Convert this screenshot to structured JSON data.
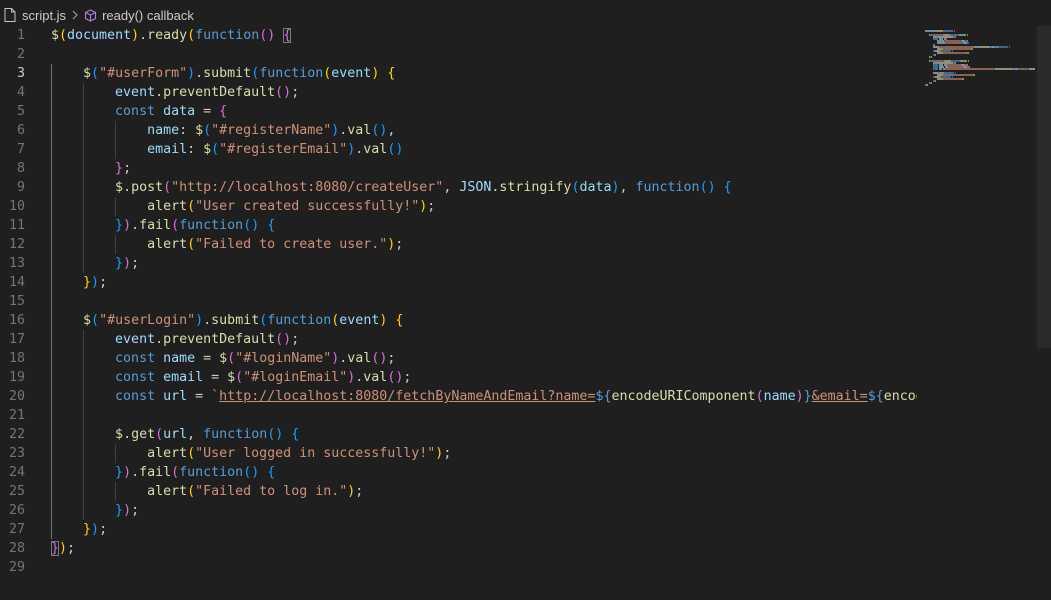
{
  "breadcrumb": {
    "file": "script.js",
    "symbol": "ready() callback",
    "file_icon": "file-icon",
    "symbol_icon": "cube-icon"
  },
  "line_numbers": [
    "1",
    "2",
    "3",
    "4",
    "5",
    "6",
    "7",
    "8",
    "9",
    "10",
    "11",
    "12",
    "13",
    "14",
    "15",
    "16",
    "17",
    "18",
    "19",
    "20",
    "21",
    "22",
    "23",
    "24",
    "25",
    "26",
    "27",
    "28",
    "29"
  ],
  "active_line": 3,
  "code_lines": [
    [
      [
        "t-fn",
        "$"
      ],
      [
        "t-p1",
        "("
      ],
      [
        "t-var",
        "document"
      ],
      [
        "t-p1",
        ")"
      ],
      [
        "t-pl",
        "."
      ],
      [
        "t-fn",
        "ready"
      ],
      [
        "t-p1",
        "("
      ],
      [
        "t-kw",
        "function"
      ],
      [
        "t-p2",
        "()"
      ],
      [
        "t-pl",
        " "
      ],
      [
        "t-p2 cursor-bracket",
        "{"
      ]
    ],
    [],
    [
      [
        "t-pl",
        "    "
      ],
      [
        "t-fn",
        "$"
      ],
      [
        "t-p3",
        "("
      ],
      [
        "t-str",
        "\"#userForm\""
      ],
      [
        "t-p3",
        ")"
      ],
      [
        "t-pl",
        "."
      ],
      [
        "t-fn",
        "submit"
      ],
      [
        "t-p3",
        "("
      ],
      [
        "t-kw",
        "function"
      ],
      [
        "t-p1",
        "("
      ],
      [
        "t-var",
        "event"
      ],
      [
        "t-p1",
        ")"
      ],
      [
        "t-pl",
        " "
      ],
      [
        "t-p1",
        "{"
      ]
    ],
    [
      [
        "t-pl",
        "        "
      ],
      [
        "t-var",
        "event"
      ],
      [
        "t-pl",
        "."
      ],
      [
        "t-fn",
        "preventDefault"
      ],
      [
        "t-p2",
        "()"
      ],
      [
        "t-pl",
        ";"
      ]
    ],
    [
      [
        "t-pl",
        "        "
      ],
      [
        "t-kw",
        "const"
      ],
      [
        "t-pl",
        " "
      ],
      [
        "t-var",
        "data"
      ],
      [
        "t-pl",
        " = "
      ],
      [
        "t-p2",
        "{"
      ]
    ],
    [
      [
        "t-pl",
        "            "
      ],
      [
        "t-var",
        "name"
      ],
      [
        "t-pl",
        ": "
      ],
      [
        "t-fn",
        "$"
      ],
      [
        "t-p3",
        "("
      ],
      [
        "t-str",
        "\"#registerName\""
      ],
      [
        "t-p3",
        ")"
      ],
      [
        "t-pl",
        "."
      ],
      [
        "t-fn",
        "val"
      ],
      [
        "t-p3",
        "()"
      ],
      [
        "t-pl",
        ","
      ]
    ],
    [
      [
        "t-pl",
        "            "
      ],
      [
        "t-var",
        "email"
      ],
      [
        "t-pl",
        ": "
      ],
      [
        "t-fn",
        "$"
      ],
      [
        "t-p3",
        "("
      ],
      [
        "t-str",
        "\"#registerEmail\""
      ],
      [
        "t-p3",
        ")"
      ],
      [
        "t-pl",
        "."
      ],
      [
        "t-fn",
        "val"
      ],
      [
        "t-p3",
        "()"
      ]
    ],
    [
      [
        "t-pl",
        "        "
      ],
      [
        "t-p2",
        "}"
      ],
      [
        "t-pl",
        ";"
      ]
    ],
    [
      [
        "t-pl",
        "        "
      ],
      [
        "t-fn",
        "$"
      ],
      [
        "t-pl",
        "."
      ],
      [
        "t-fn",
        "post"
      ],
      [
        "t-p2",
        "("
      ],
      [
        "t-str",
        "\"http://localhost:8080/createUser\""
      ],
      [
        "t-pl",
        ", "
      ],
      [
        "t-var",
        "JSON"
      ],
      [
        "t-pl",
        "."
      ],
      [
        "t-fn",
        "stringify"
      ],
      [
        "t-p3",
        "("
      ],
      [
        "t-var",
        "data"
      ],
      [
        "t-p3",
        ")"
      ],
      [
        "t-pl",
        ", "
      ],
      [
        "t-kw",
        "function"
      ],
      [
        "t-p3",
        "()"
      ],
      [
        "t-pl",
        " "
      ],
      [
        "t-p3",
        "{"
      ]
    ],
    [
      [
        "t-pl",
        "            "
      ],
      [
        "t-fn",
        "alert"
      ],
      [
        "t-p1",
        "("
      ],
      [
        "t-str",
        "\"User created successfully!\""
      ],
      [
        "t-p1",
        ")"
      ],
      [
        "t-pl",
        ";"
      ]
    ],
    [
      [
        "t-pl",
        "        "
      ],
      [
        "t-p3",
        "}"
      ],
      [
        "t-p2",
        ")"
      ],
      [
        "t-pl",
        "."
      ],
      [
        "t-fn",
        "fail"
      ],
      [
        "t-p2",
        "("
      ],
      [
        "t-kw",
        "function"
      ],
      [
        "t-p3",
        "()"
      ],
      [
        "t-pl",
        " "
      ],
      [
        "t-p3",
        "{"
      ]
    ],
    [
      [
        "t-pl",
        "            "
      ],
      [
        "t-fn",
        "alert"
      ],
      [
        "t-p1",
        "("
      ],
      [
        "t-str",
        "\"Failed to create user.\""
      ],
      [
        "t-p1",
        ")"
      ],
      [
        "t-pl",
        ";"
      ]
    ],
    [
      [
        "t-pl",
        "        "
      ],
      [
        "t-p3",
        "}"
      ],
      [
        "t-p2",
        ")"
      ],
      [
        "t-pl",
        ";"
      ]
    ],
    [
      [
        "t-pl",
        "    "
      ],
      [
        "t-p1",
        "}"
      ],
      [
        "t-p3",
        ")"
      ],
      [
        "t-pl",
        ";"
      ]
    ],
    [],
    [
      [
        "t-pl",
        "    "
      ],
      [
        "t-fn",
        "$"
      ],
      [
        "t-p3",
        "("
      ],
      [
        "t-str",
        "\"#userLogin\""
      ],
      [
        "t-p3",
        ")"
      ],
      [
        "t-pl",
        "."
      ],
      [
        "t-fn",
        "submit"
      ],
      [
        "t-p3",
        "("
      ],
      [
        "t-kw",
        "function"
      ],
      [
        "t-p1",
        "("
      ],
      [
        "t-var",
        "event"
      ],
      [
        "t-p1",
        ")"
      ],
      [
        "t-pl",
        " "
      ],
      [
        "t-p1",
        "{"
      ]
    ],
    [
      [
        "t-pl",
        "        "
      ],
      [
        "t-var",
        "event"
      ],
      [
        "t-pl",
        "."
      ],
      [
        "t-fn",
        "preventDefault"
      ],
      [
        "t-p2",
        "()"
      ],
      [
        "t-pl",
        ";"
      ]
    ],
    [
      [
        "t-pl",
        "        "
      ],
      [
        "t-kw",
        "const"
      ],
      [
        "t-pl",
        " "
      ],
      [
        "t-var",
        "name"
      ],
      [
        "t-pl",
        " = "
      ],
      [
        "t-fn",
        "$"
      ],
      [
        "t-p2",
        "("
      ],
      [
        "t-str",
        "\"#loginName\""
      ],
      [
        "t-p2",
        ")"
      ],
      [
        "t-pl",
        "."
      ],
      [
        "t-fn",
        "val"
      ],
      [
        "t-p2",
        "()"
      ],
      [
        "t-pl",
        ";"
      ]
    ],
    [
      [
        "t-pl",
        "        "
      ],
      [
        "t-kw",
        "const"
      ],
      [
        "t-pl",
        " "
      ],
      [
        "t-var",
        "email"
      ],
      [
        "t-pl",
        " = "
      ],
      [
        "t-fn",
        "$"
      ],
      [
        "t-p2",
        "("
      ],
      [
        "t-str",
        "\"#loginEmail\""
      ],
      [
        "t-p2",
        ")"
      ],
      [
        "t-pl",
        "."
      ],
      [
        "t-fn",
        "val"
      ],
      [
        "t-p2",
        "()"
      ],
      [
        "t-pl",
        ";"
      ]
    ],
    [
      [
        "t-pl",
        "        "
      ],
      [
        "t-kw",
        "const"
      ],
      [
        "t-pl",
        " "
      ],
      [
        "t-var",
        "url"
      ],
      [
        "t-pl",
        " = "
      ],
      [
        "t-str",
        "`"
      ],
      [
        "t-url",
        "http://localhost:8080/fetchByNameAndEmail?name="
      ],
      [
        "t-tpl",
        "${"
      ],
      [
        "t-fn",
        "encodeURIComponent"
      ],
      [
        "t-p2",
        "("
      ],
      [
        "t-var",
        "name"
      ],
      [
        "t-p2",
        ")"
      ],
      [
        "t-tpl",
        "}"
      ],
      [
        "t-url",
        "&email="
      ],
      [
        "t-tpl",
        "${"
      ],
      [
        "t-fn",
        "encodeURI"
      ]
    ],
    [],
    [
      [
        "t-pl",
        "        "
      ],
      [
        "t-fn",
        "$"
      ],
      [
        "t-pl",
        "."
      ],
      [
        "t-fn",
        "get"
      ],
      [
        "t-p2",
        "("
      ],
      [
        "t-var",
        "url"
      ],
      [
        "t-pl",
        ", "
      ],
      [
        "t-kw",
        "function"
      ],
      [
        "t-p3",
        "()"
      ],
      [
        "t-pl",
        " "
      ],
      [
        "t-p3",
        "{"
      ]
    ],
    [
      [
        "t-pl",
        "            "
      ],
      [
        "t-fn",
        "alert"
      ],
      [
        "t-p1",
        "("
      ],
      [
        "t-str",
        "\"User logged in successfully!\""
      ],
      [
        "t-p1",
        ")"
      ],
      [
        "t-pl",
        ";"
      ]
    ],
    [
      [
        "t-pl",
        "        "
      ],
      [
        "t-p3",
        "}"
      ],
      [
        "t-p2",
        ")"
      ],
      [
        "t-pl",
        "."
      ],
      [
        "t-fn",
        "fail"
      ],
      [
        "t-p2",
        "("
      ],
      [
        "t-kw",
        "function"
      ],
      [
        "t-p3",
        "()"
      ],
      [
        "t-pl",
        " "
      ],
      [
        "t-p3",
        "{"
      ]
    ],
    [
      [
        "t-pl",
        "            "
      ],
      [
        "t-fn",
        "alert"
      ],
      [
        "t-p1",
        "("
      ],
      [
        "t-str",
        "\"Failed to log in.\""
      ],
      [
        "t-p1",
        ")"
      ],
      [
        "t-pl",
        ";"
      ]
    ],
    [
      [
        "t-pl",
        "        "
      ],
      [
        "t-p3",
        "}"
      ],
      [
        "t-p2",
        ")"
      ],
      [
        "t-pl",
        ";"
      ]
    ],
    [
      [
        "t-pl",
        "    "
      ],
      [
        "t-p1",
        "}"
      ],
      [
        "t-p3",
        ")"
      ],
      [
        "t-pl",
        ";"
      ]
    ],
    [
      [
        "t-p2 cursor-bracket",
        "}"
      ],
      [
        "t-p1",
        ")"
      ],
      [
        "t-pl",
        ";"
      ]
    ],
    []
  ],
  "colors": {
    "background": "#1f1f1f",
    "line_number": "#6e7681",
    "active_line_number": "#cccccc",
    "keyword": "#569cd6",
    "function": "#dcdcaa",
    "string": "#ce9178",
    "variable": "#9cdcfe"
  }
}
